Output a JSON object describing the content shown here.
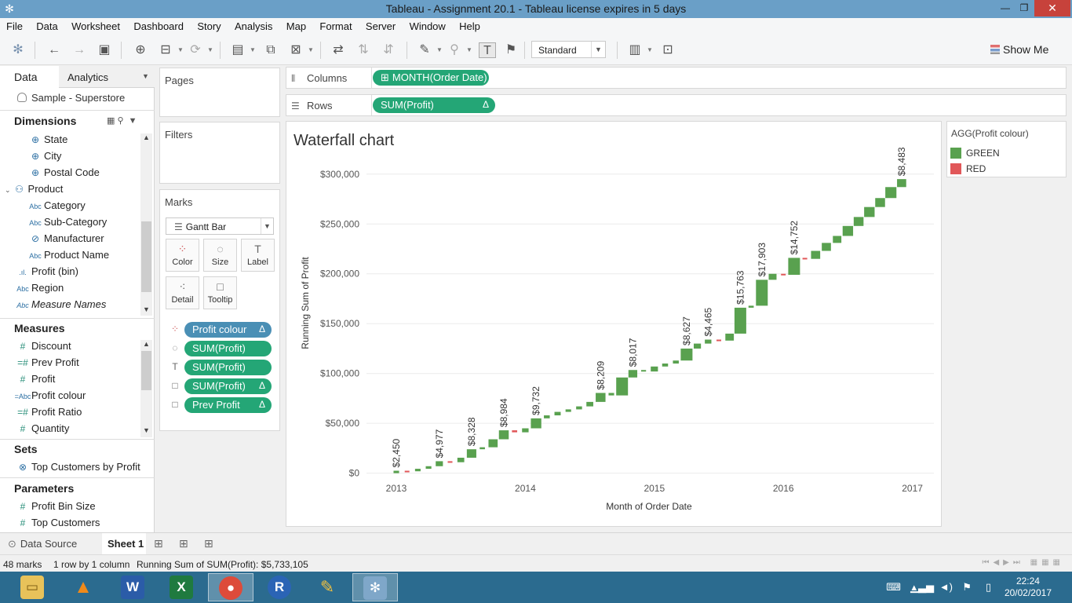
{
  "window": {
    "title": "Tableau - Assignment 20.1 - Tableau license expires in 5 days"
  },
  "menu": [
    "File",
    "Data",
    "Worksheet",
    "Dashboard",
    "Story",
    "Analysis",
    "Map",
    "Format",
    "Server",
    "Window",
    "Help"
  ],
  "toolbar": {
    "standard": "Standard",
    "show_me": "Show Me"
  },
  "datapane": {
    "tab_data": "Data",
    "tab_analytics": "Analytics",
    "datasource": "Sample - Superstore",
    "dimensions_header": "Dimensions",
    "dimensions": [
      {
        "icon": "globe",
        "label": "State"
      },
      {
        "icon": "globe",
        "label": "City"
      },
      {
        "icon": "globe",
        "label": "Postal Code"
      },
      {
        "icon": "hierarchy",
        "label": "Product"
      },
      {
        "icon": "Abc",
        "label": "Category"
      },
      {
        "icon": "Abc",
        "label": "Sub-Category"
      },
      {
        "icon": "clip",
        "label": "Manufacturer"
      },
      {
        "icon": "Abc",
        "label": "Product Name"
      },
      {
        "icon": "bin",
        "label": "Profit (bin)"
      },
      {
        "icon": "Abc",
        "label": "Region"
      },
      {
        "icon": "Abc",
        "label": "Measure Names"
      }
    ],
    "measures_header": "Measures",
    "measures": [
      {
        "icon": "#",
        "label": "Discount"
      },
      {
        "icon": "=#",
        "label": "Prev Profit"
      },
      {
        "icon": "#",
        "label": "Profit"
      },
      {
        "icon": "=Abc",
        "label": "Profit colour"
      },
      {
        "icon": "=#",
        "label": "Profit Ratio"
      },
      {
        "icon": "#",
        "label": "Quantity"
      }
    ],
    "sets_header": "Sets",
    "sets": [
      "Top Customers by Profit"
    ],
    "parameters_header": "Parameters",
    "parameters": [
      "Profit Bin Size",
      "Top Customers"
    ]
  },
  "cards": {
    "pages": "Pages",
    "filters": "Filters",
    "marks": "Marks",
    "mark_type": "Gantt Bar",
    "buttons": [
      "Color",
      "Size",
      "Label",
      "Detail",
      "Tooltip"
    ],
    "pills": [
      {
        "label": "Profit colour",
        "delta": "Δ",
        "kind": "blue",
        "icon": "color"
      },
      {
        "label": "SUM(Profit)",
        "delta": "",
        "kind": "green",
        "icon": "size"
      },
      {
        "label": "SUM(Profit)",
        "delta": "",
        "kind": "green",
        "icon": "label"
      },
      {
        "label": "SUM(Profit)",
        "delta": "Δ",
        "kind": "green",
        "icon": "tooltip"
      },
      {
        "label": "Prev Profit",
        "delta": "Δ",
        "kind": "green",
        "icon": "tooltip"
      }
    ]
  },
  "shelves": {
    "columns_label": "Columns",
    "columns_pill": "MONTH(Order Date)",
    "rows_label": "Rows",
    "rows_pill": "SUM(Profit)",
    "rows_delta": "Δ"
  },
  "legend": {
    "title": "AGG(Profit colour)",
    "items": [
      {
        "label": "GREEN",
        "color": "#59a14f"
      },
      {
        "label": "RED",
        "color": "#e15759"
      }
    ]
  },
  "chart_data": {
    "type": "bar",
    "subtype": "waterfall",
    "title": "Waterfall chart",
    "xlabel": "Month of Order Date",
    "ylabel": "Running Sum of Profit",
    "x_ticks": [
      "2013",
      "2014",
      "2015",
      "2016",
      "2017"
    ],
    "y_ticks": [
      "$0",
      "$50,000",
      "$100,000",
      "$150,000",
      "$200,000",
      "$250,000",
      "$300,000"
    ],
    "ylim": [
      -5000,
      314000
    ],
    "grid": true,
    "colors": {
      "GREEN": "#59a14f",
      "RED": "#e15759"
    },
    "months": [
      {
        "m": 0,
        "end": 2450,
        "color": "GREEN",
        "label": "$2,450"
      },
      {
        "m": 1,
        "end": 1900,
        "color": "RED"
      },
      {
        "m": 2,
        "end": 4400,
        "color": "GREEN"
      },
      {
        "m": 3,
        "end": 7000,
        "color": "GREEN"
      },
      {
        "m": 4,
        "end": 12000,
        "color": "GREEN",
        "label": "$4,977"
      },
      {
        "m": 5,
        "end": 11000,
        "color": "RED"
      },
      {
        "m": 6,
        "end": 15500,
        "color": "GREEN"
      },
      {
        "m": 7,
        "end": 24000,
        "color": "GREEN",
        "label": "$8,328"
      },
      {
        "m": 8,
        "end": 26000,
        "color": "GREEN"
      },
      {
        "m": 9,
        "end": 34000,
        "color": "GREEN"
      },
      {
        "m": 10,
        "end": 43000,
        "color": "GREEN",
        "label": "$8,984"
      },
      {
        "m": 11,
        "end": 41000,
        "color": "RED"
      },
      {
        "m": 12,
        "end": 45000,
        "color": "GREEN"
      },
      {
        "m": 13,
        "end": 55000,
        "color": "GREEN",
        "label": "$9,732"
      },
      {
        "m": 14,
        "end": 58000,
        "color": "GREEN"
      },
      {
        "m": 15,
        "end": 61500,
        "color": "GREEN"
      },
      {
        "m": 16,
        "end": 64000,
        "color": "GREEN"
      },
      {
        "m": 17,
        "end": 67000,
        "color": "GREEN"
      },
      {
        "m": 18,
        "end": 71500,
        "color": "GREEN"
      },
      {
        "m": 19,
        "end": 80500,
        "color": "GREEN",
        "label": "$8,209"
      },
      {
        "m": 20,
        "end": 78000,
        "color": "GREEN"
      },
      {
        "m": 21,
        "end": 96000,
        "color": "GREEN"
      },
      {
        "m": 22,
        "end": 103500,
        "color": "GREEN",
        "label": "$8,017"
      },
      {
        "m": 23,
        "end": 102000,
        "color": "GREEN"
      },
      {
        "m": 24,
        "end": 107000,
        "color": "GREEN"
      },
      {
        "m": 25,
        "end": 110000,
        "color": "GREEN"
      },
      {
        "m": 26,
        "end": 113000,
        "color": "GREEN"
      },
      {
        "m": 27,
        "end": 125000,
        "color": "GREEN",
        "label": "$8,627"
      },
      {
        "m": 28,
        "end": 130000,
        "color": "GREEN"
      },
      {
        "m": 29,
        "end": 134000,
        "color": "GREEN",
        "label": "$4,465"
      },
      {
        "m": 30,
        "end": 133000,
        "color": "RED"
      },
      {
        "m": 31,
        "end": 140000,
        "color": "GREEN"
      },
      {
        "m": 32,
        "end": 166000,
        "color": "GREEN",
        "label": "$15,763"
      },
      {
        "m": 33,
        "end": 168000,
        "color": "GREEN"
      },
      {
        "m": 34,
        "end": 194000,
        "color": "GREEN",
        "label": "$17,903"
      },
      {
        "m": 35,
        "end": 200000,
        "color": "GREEN"
      },
      {
        "m": 36,
        "end": 199000,
        "color": "RED"
      },
      {
        "m": 37,
        "end": 216000,
        "color": "GREEN",
        "label": "$14,752"
      },
      {
        "m": 38,
        "end": 215000,
        "color": "RED"
      },
      {
        "m": 39,
        "end": 223000,
        "color": "GREEN"
      },
      {
        "m": 40,
        "end": 231000,
        "color": "GREEN"
      },
      {
        "m": 41,
        "end": 238000,
        "color": "GREEN"
      },
      {
        "m": 42,
        "end": 248000,
        "color": "GREEN"
      },
      {
        "m": 43,
        "end": 257000,
        "color": "GREEN"
      },
      {
        "m": 44,
        "end": 267000,
        "color": "GREEN"
      },
      {
        "m": 45,
        "end": 276000,
        "color": "GREEN"
      },
      {
        "m": 46,
        "end": 287000,
        "color": "GREEN"
      },
      {
        "m": 47,
        "end": 295000,
        "color": "GREEN",
        "label": "$8,483"
      }
    ]
  },
  "sheettabs": {
    "data_source": "Data Source",
    "sheet": "Sheet 1"
  },
  "status": {
    "marks": "48 marks",
    "dims": "1 row by 1 column",
    "sum": "Running Sum of SUM(Profit): $5,733,105"
  },
  "taskbar": {
    "time": "22:24",
    "date": "20/02/2017",
    "apps": [
      "file-explorer",
      "vlc",
      "word",
      "excel",
      "chrome",
      "r",
      "paint",
      "tableau"
    ]
  }
}
